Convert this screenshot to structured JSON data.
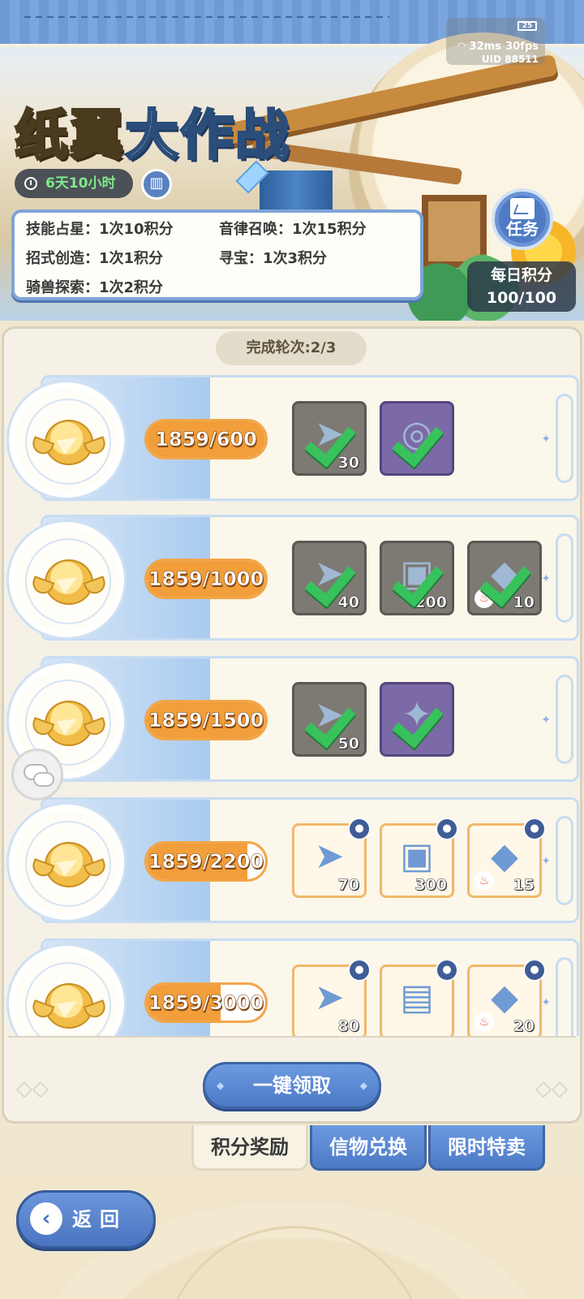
{
  "status": {
    "battery": "25",
    "ping": "32ms",
    "fps": "30fps",
    "uid": "UID 88511"
  },
  "header": {
    "title_part1": "纸翼",
    "title_part2": "大作战",
    "timer": "6天10小时",
    "book_icon": "book-icon"
  },
  "rules": [
    "技能占星：1次10积分",
    "音律召唤：1次15积分",
    "招式创造：1次1积分",
    "寻宝：1次3积分",
    "骑兽探索：1次2积分"
  ],
  "task_button": {
    "label": "任务"
  },
  "daily_points": {
    "label": "每日积分",
    "value": "100/100"
  },
  "rounds": {
    "label": "完成轮次:2/3"
  },
  "tiers": [
    {
      "progress": "1859/600",
      "fraction": 1.0,
      "items": [
        {
          "icon": "paper-plane",
          "qty": "30",
          "state": "claimed",
          "color": "gray"
        },
        {
          "icon": "coin-frame",
          "qty": "",
          "state": "claimed",
          "color": "purple"
        }
      ]
    },
    {
      "progress": "1859/1000",
      "fraction": 1.0,
      "items": [
        {
          "icon": "paper-plane",
          "qty": "40",
          "state": "claimed",
          "color": "gray"
        },
        {
          "icon": "canister",
          "qty": "200",
          "state": "claimed",
          "color": "gray"
        },
        {
          "icon": "ore",
          "qty": "10",
          "state": "claimed",
          "color": "gray"
        }
      ]
    },
    {
      "progress": "1859/1500",
      "fraction": 1.0,
      "items": [
        {
          "icon": "paper-plane",
          "qty": "50",
          "state": "claimed",
          "color": "gray"
        },
        {
          "icon": "emblem-frame",
          "qty": "",
          "state": "claimed",
          "color": "purple"
        }
      ]
    },
    {
      "progress": "1859/2200",
      "fraction": 0.845,
      "items": [
        {
          "icon": "paper-plane",
          "qty": "70",
          "state": "locked",
          "color": "orange"
        },
        {
          "icon": "canister",
          "qty": "300",
          "state": "locked",
          "color": "orange"
        },
        {
          "icon": "ore",
          "qty": "15",
          "state": "locked",
          "color": "orange"
        }
      ]
    },
    {
      "progress": "1859/3000",
      "fraction": 0.62,
      "items": [
        {
          "icon": "paper-plane",
          "qty": "80",
          "state": "locked",
          "color": "orange"
        },
        {
          "icon": "scroll-chest",
          "qty": "",
          "state": "locked",
          "color": "orange"
        },
        {
          "icon": "ore",
          "qty": "20",
          "state": "locked",
          "color": "orange"
        }
      ]
    }
  ],
  "actions": {
    "claim_all": "一键领取",
    "back": "返回"
  },
  "tabs": [
    {
      "label": "积分奖励",
      "active": true
    },
    {
      "label": "信物兑换",
      "active": false
    },
    {
      "label": "限时特卖",
      "active": false
    }
  ]
}
